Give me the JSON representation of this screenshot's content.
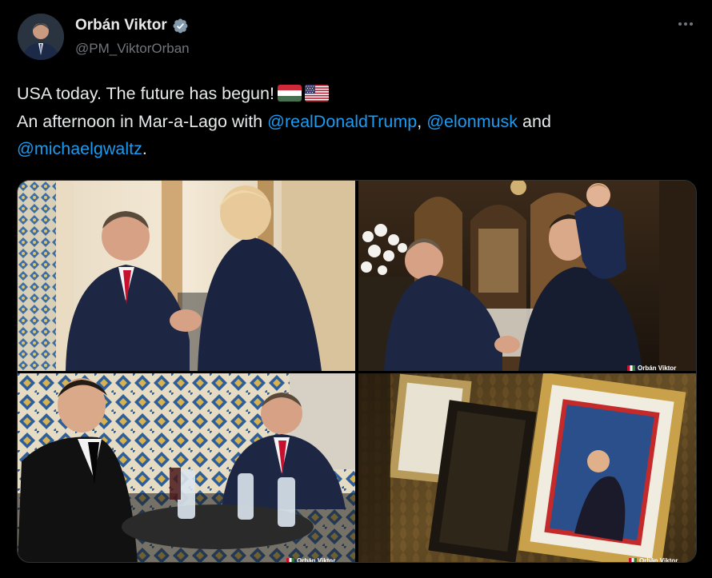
{
  "author": {
    "display_name": "Orbán Viktor",
    "handle": "@PM_ViktorOrban",
    "verified": true
  },
  "icons": {
    "verified": "verified-badge-icon",
    "more": "more-options-icon",
    "flag_hu": "hungary-flag-icon",
    "flag_us": "usa-flag-icon"
  },
  "tweet": {
    "line1_text": "USA today. The future has begun!",
    "line2_prefix": "An afternoon in Mar-a-Lago with ",
    "mention_1": "@realDonaldTrump",
    "sep_1": ", ",
    "mention_2": "@elonmusk",
    "sep_2": " and",
    "mention_3": "@michaelgwaltz",
    "suffix": "."
  },
  "media": {
    "photo_count": 4,
    "watermark": "Orbán Viktor"
  },
  "colors": {
    "background": "#000000",
    "text": "#e7e9ea",
    "secondary": "#71767b",
    "accent": "#1d9bf0"
  }
}
